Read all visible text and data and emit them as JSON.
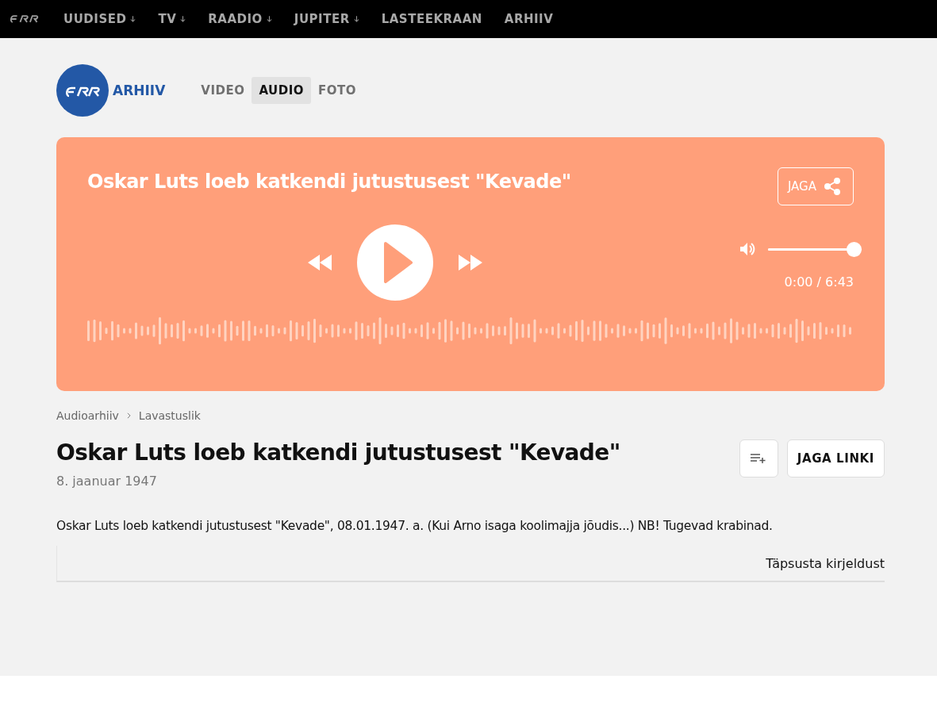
{
  "topnav": {
    "items": [
      {
        "label": "UUDISED",
        "has_menu": true
      },
      {
        "label": "TV",
        "has_menu": true
      },
      {
        "label": "RAADIO",
        "has_menu": true
      },
      {
        "label": "JUPITER",
        "has_menu": true
      },
      {
        "label": "LASTEEKRAAN",
        "has_menu": false
      },
      {
        "label": "ARHIIV",
        "has_menu": false
      }
    ]
  },
  "brand": {
    "label": "ARHIIV"
  },
  "media_tabs": [
    {
      "label": "VIDEO",
      "selected": false
    },
    {
      "label": "AUDIO",
      "selected": true
    },
    {
      "label": "FOTO",
      "selected": false
    }
  ],
  "player": {
    "title": "Oskar Luts loeb katkendi jutustusest \"Kevade\"",
    "share_label": "JAGA",
    "volume": {
      "level": 1.0
    },
    "time": "0:00 / 6:43"
  },
  "breadcrumb": [
    "Audioarhiiv",
    "Lavastuslik"
  ],
  "article": {
    "title": "Oskar Luts loeb katkendi jutustusest \"Kevade\"",
    "date": "8. jaanuar 1947",
    "share_link_label": "JAGA LINKI",
    "description": "Oskar Luts loeb katkendi jutustusest \"Kevade\", 08.01.1947. a. (Kui Arno isaga koolimajja jõudis...) NB! Tugevad krabinad.",
    "refine_label": "Täpsusta kirjeldust"
  }
}
